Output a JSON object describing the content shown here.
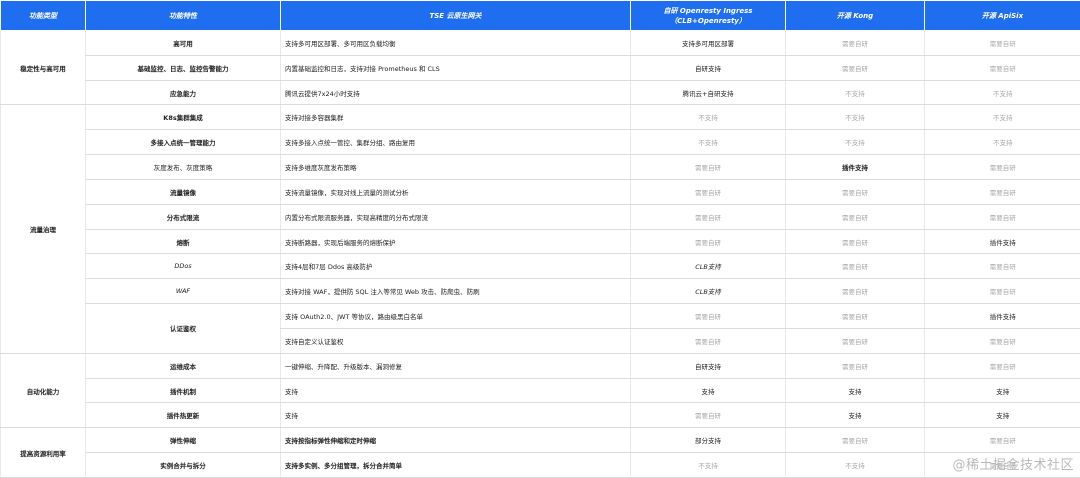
{
  "headers": [
    "功能类型",
    "功能特性",
    "TSE 云原生网关",
    "自研 Openresty Ingress\n（CLB+Openresty）",
    "开源 Kong",
    "开源 ApiSix"
  ],
  "categories": [
    "稳定性与高可用",
    "流量治理",
    "自动化能力",
    "提高资源利用率"
  ],
  "rows": [
    {
      "cat": "稳定性与高可用",
      "feature": "高可用",
      "tse": "支持多可用区部署、多可用区负载均衡",
      "openresty": "支持多可用区部署",
      "kong": "需要自研",
      "apisix": "需要自研"
    },
    {
      "feature": "基础监控、日志、监控告警能力",
      "tse": "内置基础监控和日志，支持对接 Prometheus 和 CLS",
      "openresty": "自研支持",
      "kong": "需要自研",
      "apisix": "需要自研"
    },
    {
      "feature": "应急能力",
      "tse": "腾讯云提供7x24小时支持",
      "openresty": "腾讯云+自研支持",
      "kong": "不支持",
      "apisix": "不支持"
    },
    {
      "cat": "流量治理",
      "feature": "K8s集群集成",
      "tse": "支持对接多容器集群",
      "openresty": "不支持",
      "kong": "不支持",
      "apisix": "不支持"
    },
    {
      "feature": "多接入点统一管理能力",
      "tse": "支持多接入点统一管控、集群分组、路由复用",
      "openresty": "不支持",
      "kong": "不支持",
      "apisix": "不支持"
    },
    {
      "feature": "灰度发布、灰度策略",
      "tse": "支持多维度灰度发布策略",
      "openresty": "需要自研",
      "kong": "插件支持",
      "apisix": "需要自研"
    },
    {
      "feature": "流量镜像",
      "tse": "支持流量镜像，实现对线上流量的测试分析",
      "openresty": "需要自研",
      "kong": "需要自研",
      "apisix": "需要自研"
    },
    {
      "feature": "分布式限流",
      "tse": "内置分布式限流服务器，实现高精度的分布式限流",
      "openresty": "需要自研",
      "kong": "需要自研",
      "apisix": "需要自研"
    },
    {
      "feature": "熔断",
      "tse": "支持断路器，实现后端服务的熔断保护",
      "openresty": "需要自研",
      "kong": "需要自研",
      "apisix": "插件支持"
    },
    {
      "feature": "DDos",
      "tse": "支持4层和7层 Ddos 高级防护",
      "openresty": "CLB支持",
      "kong": "需要自研",
      "apisix": "需要自研"
    },
    {
      "feature": "WAF",
      "tse": "支持对接 WAF，提供防 SQL 注入等常见 Web 攻击、防爬虫、防刷",
      "openresty": "CLB支持",
      "kong": "需要自研",
      "apisix": "需要自研"
    },
    {
      "feature": "认证鉴权",
      "tse": "支持 OAuth2.0、JWT 等协议，路由级黑白名单",
      "openresty": "需要自研",
      "kong": "需要自研",
      "apisix": "插件支持"
    },
    {
      "tse": "支持自定义认证鉴权",
      "openresty": "需要自研",
      "kong": "需要自研",
      "apisix": "需要自研"
    },
    {
      "cat": "自动化能力",
      "feature": "运维成本",
      "tse": "一键伸缩、升降配、升级版本、漏洞修复",
      "openresty": "自研支持",
      "kong": "需要自研",
      "apisix": "需要自研"
    },
    {
      "feature": "插件机制",
      "tse": "支持",
      "openresty": "支持",
      "kong": "支持",
      "apisix": "支持"
    },
    {
      "feature": "插件热更新",
      "tse": "支持",
      "openresty": "需要自研",
      "kong": "支持",
      "apisix": "支持"
    },
    {
      "cat": "提高资源利用率",
      "feature": "弹性伸缩",
      "tse": "支持按指标弹性伸缩和定时伸缩",
      "openresty": "部分支持",
      "kong": "需要自研",
      "apisix": "需要自研"
    },
    {
      "feature": "实例合并与拆分",
      "tse": "支持多实例、多分组管理，拆分合并简单",
      "openresty": "不支持",
      "kong": "不支持",
      "apisix": "需要自研"
    }
  ],
  "watermark": "@稀土掘金技术社区",
  "colors": {
    "header_bg": "#1f6ef0",
    "muted": "#a8a8a8"
  }
}
